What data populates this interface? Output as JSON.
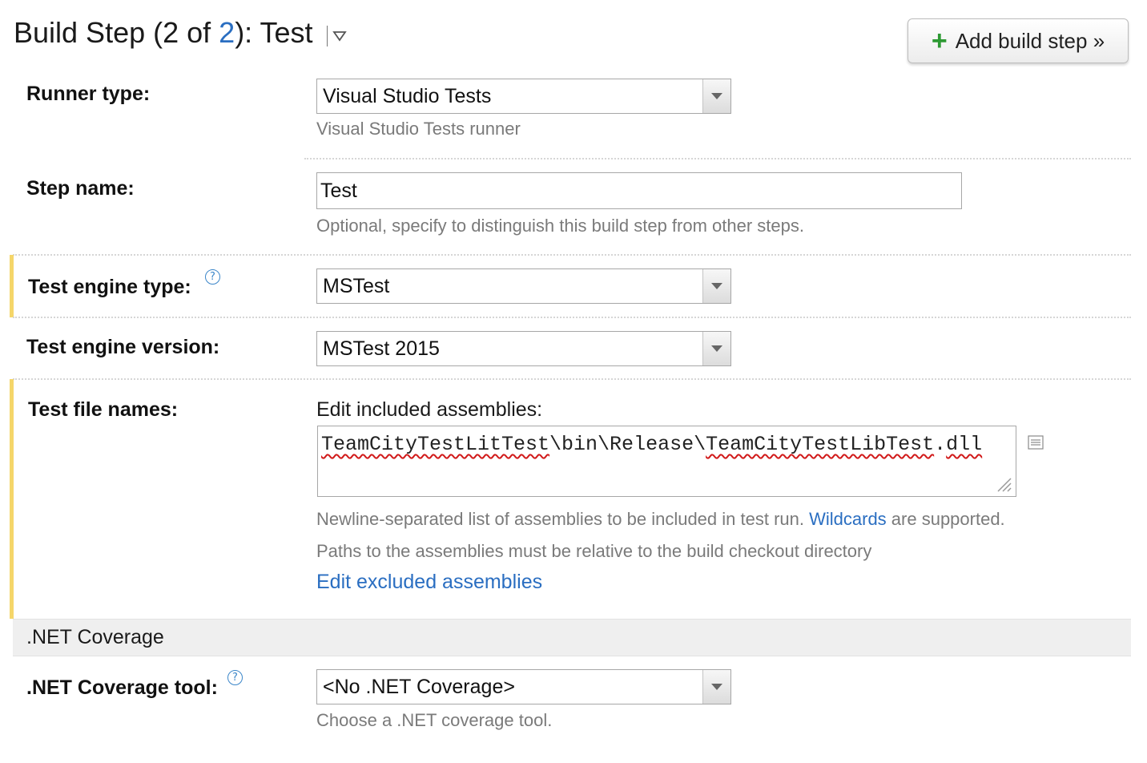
{
  "header": {
    "title_prefix": "Build Step (2 of ",
    "title_link": "2",
    "title_suffix": "): Test",
    "add_step_label": "Add build step »"
  },
  "runner_type": {
    "label": "Runner type:",
    "value": "Visual Studio Tests",
    "hint": "Visual Studio Tests runner"
  },
  "step_name": {
    "label": "Step name:",
    "value": "Test",
    "hint": "Optional, specify to distinguish this build step from other steps."
  },
  "engine_type": {
    "label": "Test engine type:",
    "value": "MSTest"
  },
  "engine_version": {
    "label": "Test engine version:",
    "value": "MSTest 2015"
  },
  "test_files": {
    "label": "Test file names:",
    "edit_label": "Edit included assemblies:",
    "path_part1": "TeamCityTestLitTest",
    "path_part2": "\\bin\\Release\\",
    "path_part3": "TeamCityTestLibTest",
    "path_part4": ".",
    "path_part5": "dll",
    "hint_part1": "Newline-separated list of assemblies to be included in test run. ",
    "hint_link": "Wildcards",
    "hint_part2": " are supported.",
    "hint2": "Paths to the assemblies must be relative to the build checkout directory",
    "excluded_link": "Edit excluded assemblies"
  },
  "coverage_section": {
    "title": ".NET Coverage"
  },
  "coverage_tool": {
    "label": ".NET Coverage tool:",
    "value": "<No .NET Coverage>",
    "hint": "Choose a .NET coverage tool."
  },
  "icons": {
    "help": "help-circle-icon",
    "dropdown": "triangle-down-icon",
    "add": "plus-icon",
    "list": "list-icon",
    "resize": "resize-grip-icon"
  },
  "colors": {
    "link": "#2a6ec1",
    "accent_bar": "#f5d66a",
    "add_icon": "#2e9a34",
    "hint_text": "#7a7a7a"
  }
}
